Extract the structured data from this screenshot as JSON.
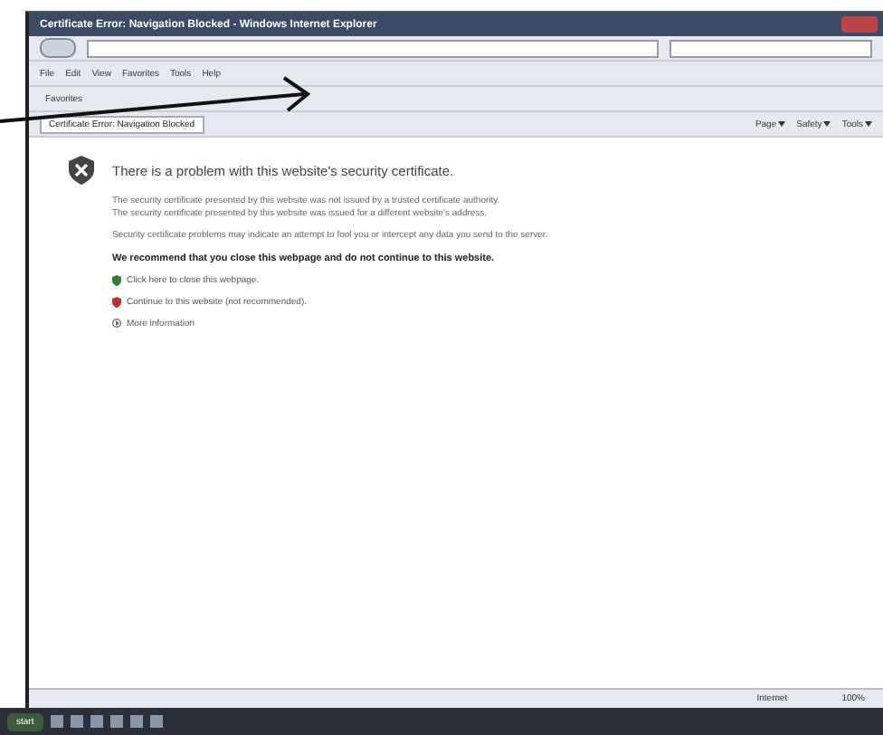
{
  "window": {
    "title": "Certificate Error: Navigation Blocked - Windows Internet Explorer"
  },
  "menu": [
    "File",
    "Edit",
    "View",
    "Favorites",
    "Tools",
    "Help"
  ],
  "favorites_bar": {
    "label": "Favorites"
  },
  "tab": {
    "label": "Certificate Error: Navigation Blocked"
  },
  "command_bar": [
    "Page",
    "Safety",
    "Tools"
  ],
  "error": {
    "heading": "There is a problem with this website's security certificate.",
    "paragraphs": [
      "The security certificate presented by this website was not issued by a trusted certificate authority.",
      "The security certificate presented by this website was issued for a different website's address.",
      "Security certificate problems may indicate an attempt to fool you or intercept any data you send to the server."
    ],
    "recommendation": "We recommend that you close this webpage and do not continue to this website.",
    "links": [
      {
        "kind": "close",
        "label": "Click here to close this webpage."
      },
      {
        "kind": "continue",
        "label": "Continue to this website (not recommended)."
      }
    ],
    "more": {
      "label": "More information",
      "expanded": false
    }
  },
  "status_bar": {
    "zone": "Internet",
    "zoom": "100%"
  },
  "taskbar": {
    "start": "start"
  }
}
